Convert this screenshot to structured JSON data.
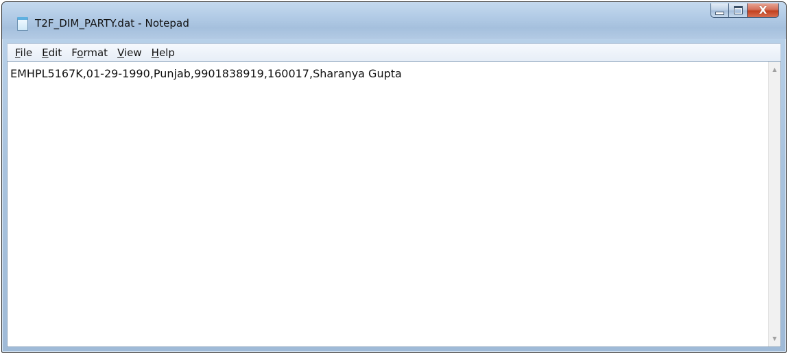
{
  "window": {
    "title": "T2F_DIM_PARTY.dat - Notepad",
    "icon": "notepad-icon",
    "close_glyph": "X"
  },
  "menu": {
    "items": [
      {
        "accel": "F",
        "rest": "ile",
        "prefix": ""
      },
      {
        "accel": "E",
        "rest": "dit",
        "prefix": ""
      },
      {
        "accel": "o",
        "rest": "rmat",
        "prefix": "F"
      },
      {
        "accel": "V",
        "rest": "iew",
        "prefix": ""
      },
      {
        "accel": "H",
        "rest": "elp",
        "prefix": ""
      }
    ]
  },
  "editor": {
    "content": "EMHPL5167K,01-29-1990,Punjab,9901838919,160017,Sharanya Gupta"
  },
  "scrollbar": {
    "up_glyph": "▲",
    "down_glyph": "▼"
  },
  "colors": {
    "titlebar": "#b2cbe6",
    "close_button": "#c2411f",
    "menubar": "#eef3f9",
    "editor_bg": "#ffffff"
  }
}
